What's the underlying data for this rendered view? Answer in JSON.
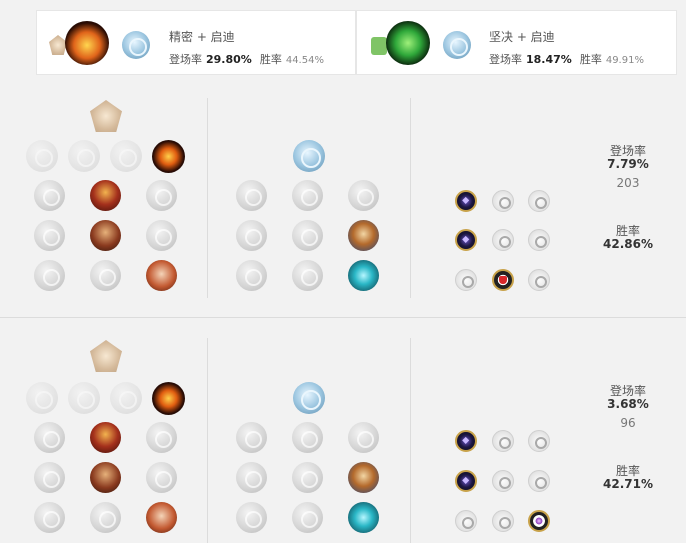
{
  "cards": [
    {
      "title": "精密 + 启迪",
      "pick_label": "登场率",
      "pick_value": "29.80%",
      "win_label": "胜率",
      "win_value": "44.54%"
    },
    {
      "title": "坚决 + 启迪",
      "pick_label": "登场率",
      "pick_value": "18.47%",
      "win_label": "胜率",
      "win_value": "49.91%"
    }
  ],
  "builds": [
    {
      "pick_label": "登场率",
      "pick_value": "7.79%",
      "games": "203",
      "win_label": "胜率",
      "win_value": "42.86%"
    },
    {
      "pick_label": "登场率",
      "pick_value": "3.68%",
      "games": "96",
      "win_label": "胜率",
      "win_value": "42.71%"
    }
  ],
  "icons": {
    "precision_tree": "precision-tree-icon",
    "resolve_tree": "resolve-tree-icon",
    "inspiration_tree": "inspiration-tree-icon",
    "keystone": "conqueror-keystone-icon"
  },
  "colors": {
    "background": "#f2f2f2",
    "card": "#ffffff",
    "shard_border": "#c8a24a"
  }
}
